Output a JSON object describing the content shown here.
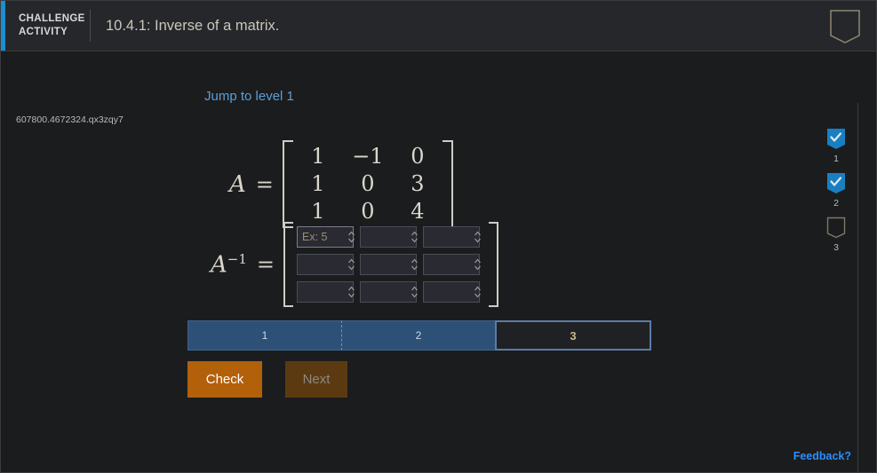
{
  "header": {
    "kicker_line1": "CHALLENGE",
    "kicker_line2": "ACTIVITY",
    "title": "10.4.1: Inverse of a matrix.",
    "bookmark_icon": "bookmark-outline-icon"
  },
  "question": {
    "id": "607800.4672324.qx3zqy7",
    "jump_link": "Jump to level 1"
  },
  "math": {
    "matrix_a": {
      "label": "A",
      "equals": "=",
      "rows": [
        [
          "1",
          "−1",
          "0"
        ],
        [
          "1",
          "0",
          "3"
        ],
        [
          "1",
          "0",
          "4"
        ]
      ]
    },
    "matrix_inverse": {
      "label": "A",
      "exponent": "−1",
      "equals": "=",
      "inputs": [
        [
          {
            "value": "",
            "placeholder": "Ex: 5",
            "focused": true
          },
          {
            "value": "",
            "placeholder": "",
            "focused": false
          },
          {
            "value": "",
            "placeholder": "",
            "focused": false
          }
        ],
        [
          {
            "value": "",
            "placeholder": "",
            "focused": false
          },
          {
            "value": "",
            "placeholder": "",
            "focused": false
          },
          {
            "value": "",
            "placeholder": "",
            "focused": false
          }
        ],
        [
          {
            "value": "",
            "placeholder": "",
            "focused": false
          },
          {
            "value": "",
            "placeholder": "",
            "focused": false
          },
          {
            "value": "",
            "placeholder": "",
            "focused": false
          }
        ]
      ]
    }
  },
  "progress": {
    "steps": [
      {
        "label": "1",
        "state": "done"
      },
      {
        "label": "2",
        "state": "done"
      },
      {
        "label": "3",
        "state": "current"
      }
    ]
  },
  "actions": {
    "check_label": "Check",
    "next_label": "Next",
    "feedback_label": "Feedback?"
  },
  "rail": {
    "items": [
      {
        "number": "1",
        "checked": true
      },
      {
        "number": "2",
        "checked": true
      },
      {
        "number": "3",
        "checked": false
      }
    ]
  },
  "colors": {
    "accent_blue": "#1a8fd1",
    "link_blue": "#5c9fd6",
    "feedback_blue": "#2a8fff",
    "check_orange": "#b3600a",
    "next_disabled": "#5c3a11",
    "progress_done": "#2d5076",
    "page_bg": "#1b1c1e",
    "header_bg": "#25272a"
  }
}
